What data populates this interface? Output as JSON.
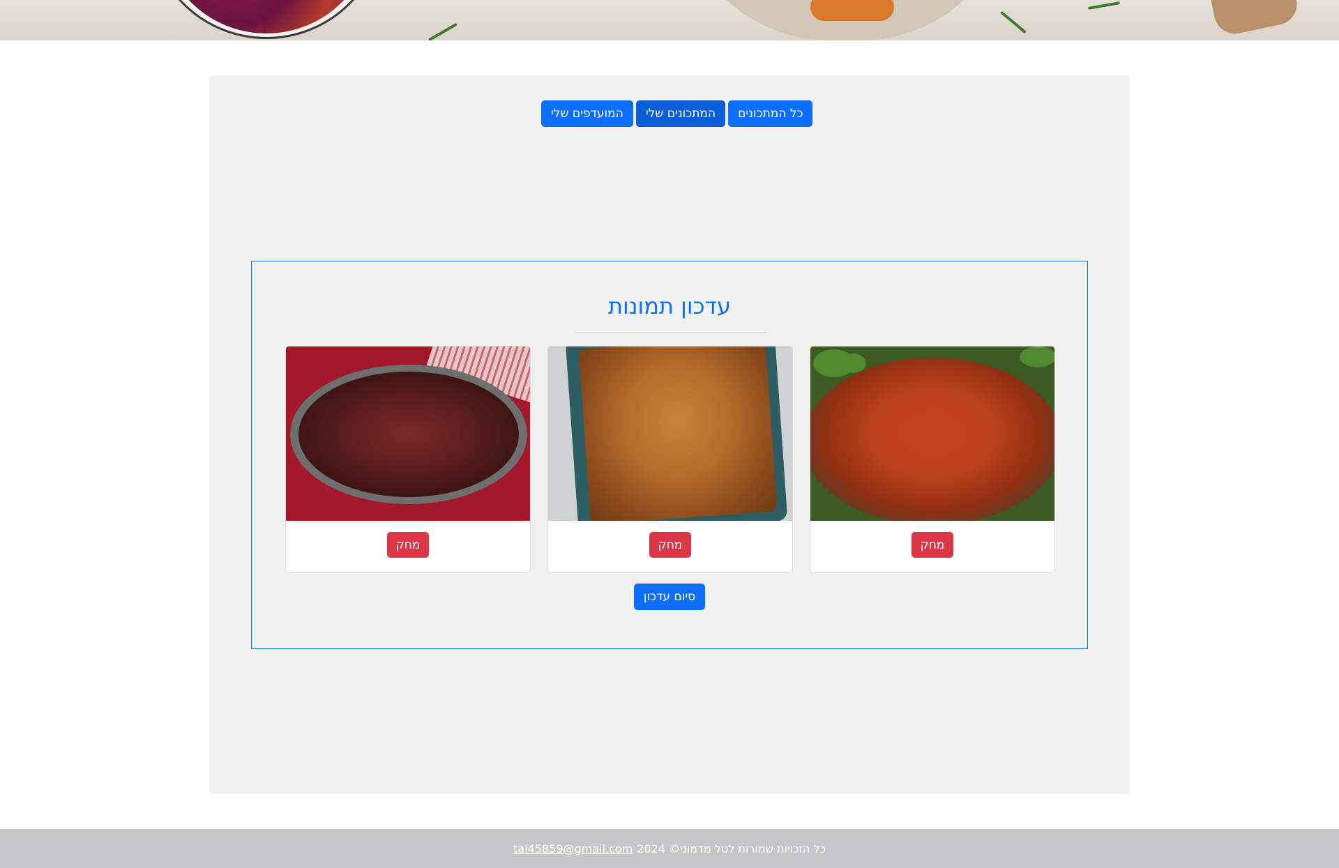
{
  "nav": {
    "all_recipes": "כל המתכונים",
    "my_recipes": "המתכונים שלי",
    "my_favorites": "המועדפים שלי",
    "active": "my_recipes"
  },
  "update_images": {
    "title": "עדכון תמונות",
    "cards": [
      {
        "image": "chicken-in-glass-bowl",
        "delete_label": "מחק"
      },
      {
        "image": "roast-chicken-tray",
        "delete_label": "מחק"
      },
      {
        "image": "chicken-drumsticks-pan",
        "delete_label": "מחק"
      }
    ],
    "finish_label": "סיום עדכון"
  },
  "footer": {
    "copyright": "כל הזכויות שמורות לטל מדמוני© 2024",
    "email": "tal45859@gmail.com"
  },
  "colors": {
    "primary": "#0d6efd",
    "primary_active": "#0b5ed7",
    "danger": "#dc3545",
    "panel": "#f1f1f1",
    "footer": "#c6c6c8"
  }
}
